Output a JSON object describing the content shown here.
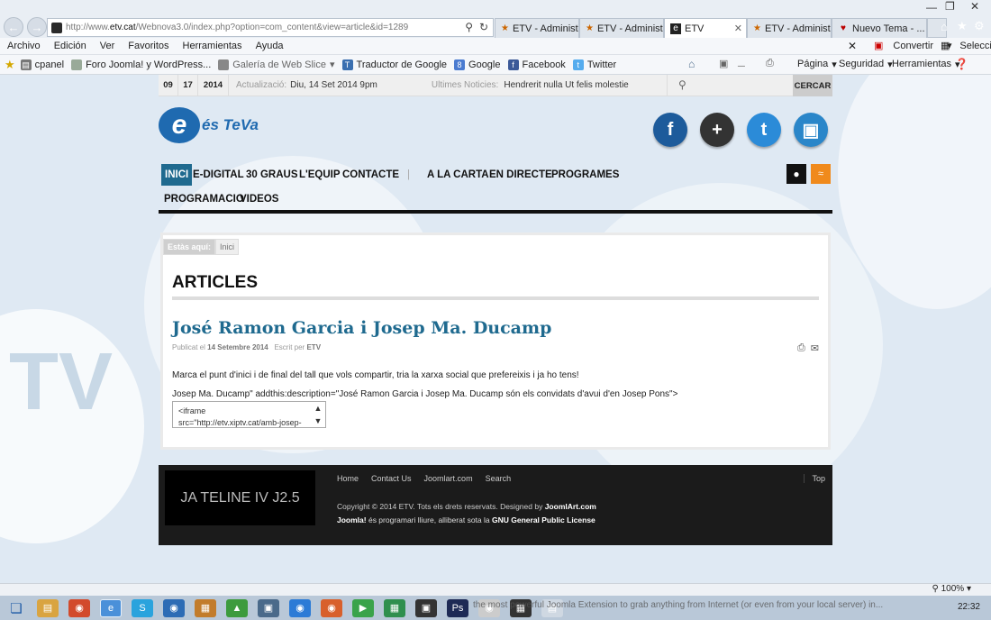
{
  "browser": {
    "url_prefix": "http://www.",
    "url_domain": "etv.cat",
    "url_path": "/Webnova3.0/index.php?option=com_content&view=article&id=1289",
    "tabs": [
      {
        "label": "ETV - Administr...",
        "active": false
      },
      {
        "label": "ETV - Administr...",
        "active": false
      },
      {
        "label": "ETV",
        "active": true
      },
      {
        "label": "ETV - Administr...",
        "active": false
      },
      {
        "label": "Nuevo Tema - ...",
        "active": false
      }
    ],
    "menu": [
      "Archivo",
      "Edición",
      "Ver",
      "Favoritos",
      "Herramientas",
      "Ayuda"
    ],
    "right_menu": {
      "convertir": "Convertir",
      "seleccionar": "Seleccionar"
    },
    "favorites": [
      "cpanel",
      "Foro Joomla! y WordPress...",
      "Galería de Web Slice",
      "Traductor de Google",
      "Google",
      "Facebook",
      "Twitter"
    ],
    "command_menu": [
      "Página",
      "Seguridad",
      "Herramientas"
    ],
    "zoom": "100%"
  },
  "site": {
    "date": {
      "day": "09",
      "month": "17",
      "year": "2014"
    },
    "update_label": "Actualizació:",
    "update_value": "Diu, 14 Set 2014 9pm",
    "news_label": "Ultimes Noticies:",
    "news_value": "Hendrerit nulla Ut felis molestie",
    "search_button": "CERCAR",
    "logo_text": "és TeVa",
    "logo_mark": "TV",
    "social": [
      "facebook",
      "google-plus",
      "twitter",
      "tumblr"
    ],
    "nav_row1": [
      "INICI",
      "E-DIGITAL",
      "30 GRAUS",
      "L'EQUIP",
      "CONTACTE",
      "|",
      "A LA CARTA",
      "EN DIRECTE",
      "PROGRAMES"
    ],
    "nav_row2": [
      "PROGRAMACIO",
      "VIDEOS"
    ]
  },
  "article": {
    "breadcrumb_here": "Estàs aquí:",
    "breadcrumb_home": "Inici",
    "section_title": "ARTICLES",
    "title": "José Ramon Garcia i Josep Ma. Ducamp",
    "published_label": "Publicat el",
    "published_date": "14 Setembre 2014",
    "author_label": "Escrit per",
    "author": "ETV",
    "paragraph1": "Marca el punt d'inici i de final del tall que vols compartir, tria la xarxa social que prefereixis i ja ho tens!",
    "paragraph2": "Josep Ma. Ducamp\" addthis:description=\"José Ramon Garcia i Josep Ma. Ducamp són els convidats d'avui d'en Josep Pons\">",
    "textarea_line1": "<iframe",
    "textarea_line2": "src=\"http://etv.xiptv.cat/amb-josep-"
  },
  "footer": {
    "box_text": "JA TELINE IV J2.5",
    "links": [
      "Home",
      "Contact Us",
      "Joomlart.com",
      "Search"
    ],
    "top": "Top",
    "copyright": "Copyright © 2014 ETV. Tots els drets reservats. Designed by",
    "designer": "JoomlArt.com",
    "license_prefix": "Joomla!",
    "license_mid": "és programari lliure, alliberat sota la",
    "license_name": "GNU General Public License"
  },
  "taskbar": {
    "ticker": "the most powerful Joomla Extension to grab anything from Internet (or even from your local server) in...",
    "time": "22:32"
  }
}
